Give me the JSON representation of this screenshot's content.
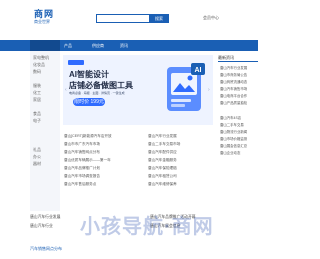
{
  "header": {
    "logo_title": "商网",
    "logo_sub": "商业世界",
    "search_placeholder": "",
    "search_button": "搜索",
    "center_link": "会员中心"
  },
  "nav": {
    "category_label": "",
    "items": [
      "产品",
      "供应商",
      "资讯"
    ]
  },
  "categories": [
    "家电整机",
    "化妆品",
    "数码",
    "服装",
    "化工",
    "家居",
    "食品",
    "电子",
    "礼品",
    "办公",
    "器材"
  ],
  "banner": {
    "title": "AI智能设计",
    "subtitle": "店铺必备做图工具",
    "tags": "电商必备 · 海报 · 主图 · 详情页 · 一键生成",
    "price": "限时价 199元",
    "art_label": "AI"
  },
  "right_panel": {
    "title": "最新资讯",
    "items": [
      "唐山汽车行业发展",
      "唐山市商务局公告",
      "唐山商贸流通动态",
      "唐山汽车销售市场",
      "唐山电商平台合作",
      "唐山产品质量抽检",
      "唐山汽车4S店",
      "唐山二手车交易",
      "唐山物流行业新闻",
      "唐山市场价格监测",
      "唐山展会信息汇总",
      "唐山企业动态"
    ]
  },
  "news_left": [
    "唐山[CERT]新能源汽车店开放",
    "唐山市市广东汽车市场",
    "唐山汽车销售网点分布",
    "唐山优质车辆展示——第一年",
    "唐山汽车品牌推广计划",
    "唐山汽车市场调查报告",
    "唐山汽车售后服务点"
  ],
  "news_right": [
    "唐山汽车行业发展",
    "唐山二手车交易市场",
    "唐山汽车配件供应",
    "唐山汽车金融服务",
    "唐山汽车保险理赔",
    "唐山汽车租赁公司",
    "唐山汽车维修保养"
  ],
  "bottom": {
    "line1_left": "唐山汽车行业发展",
    "line1_right": "唐山汽车品牌推广活动开幕",
    "line2_left": "唐山汽车行业",
    "line2_right": "唐山汽车展会信息",
    "watermark": "小孩导航·商网",
    "link": "汽车销售网点分布"
  }
}
